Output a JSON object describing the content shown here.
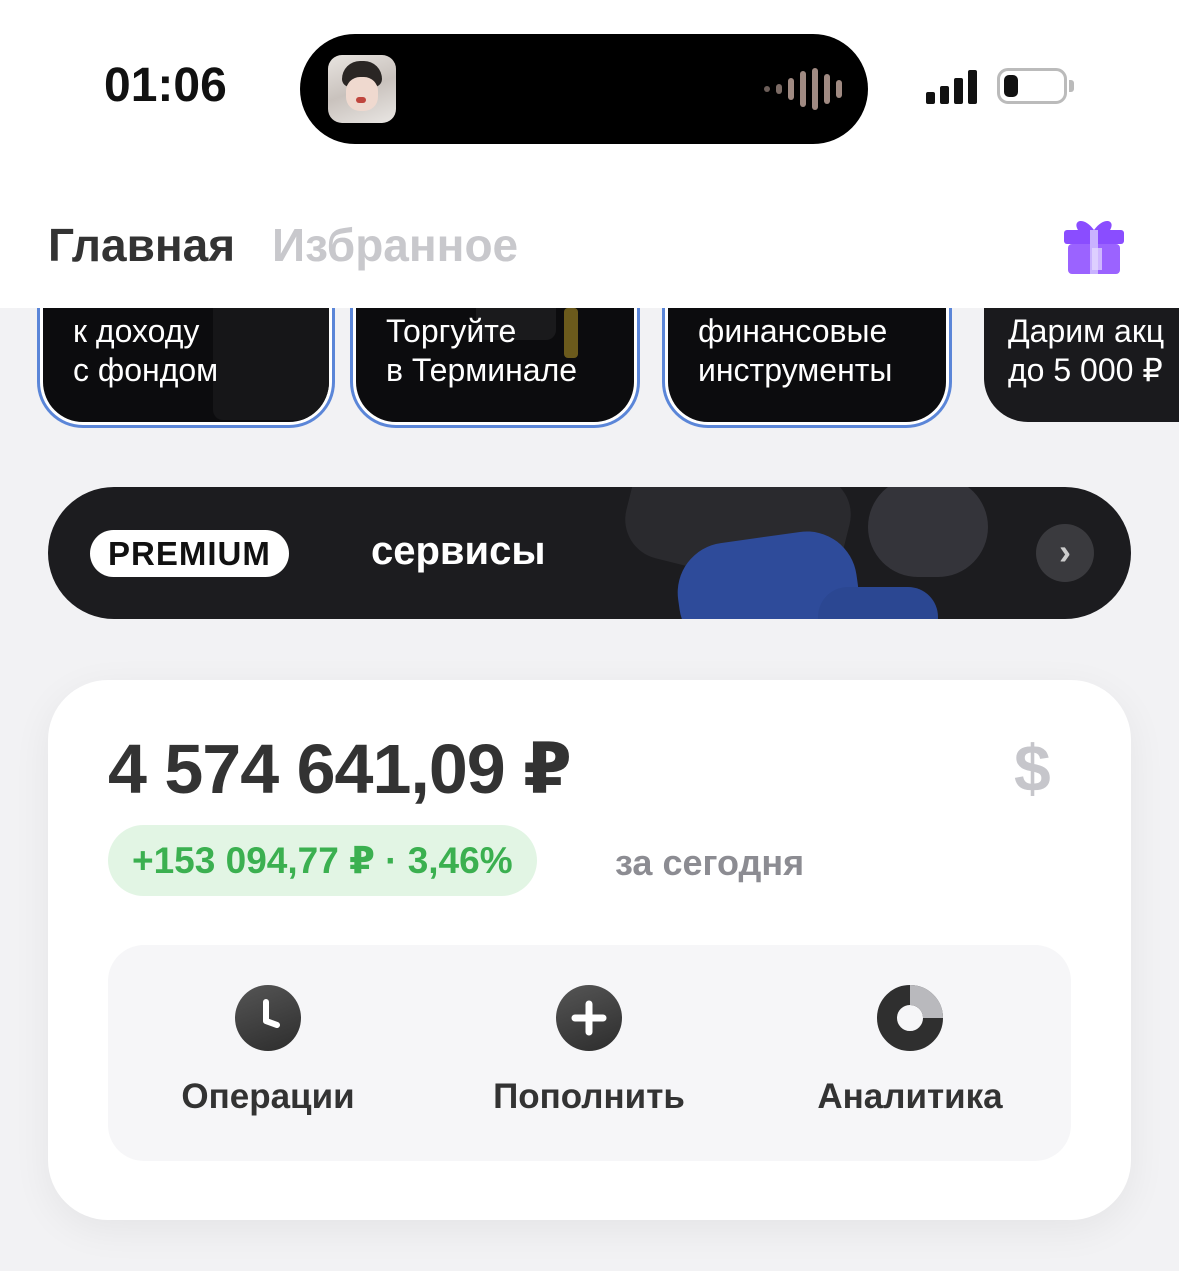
{
  "status_bar": {
    "time": "01:06"
  },
  "header": {
    "tabs": [
      {
        "label": "Главная",
        "active": true
      },
      {
        "label": "Избранное",
        "active": false
      }
    ],
    "gift_icon": "gift-icon"
  },
  "promo_cards": [
    {
      "line1": "к доходу",
      "line2": "с фондом",
      "outlined": true
    },
    {
      "line1": "Торгуйте",
      "line2": "в Терминале",
      "outlined": true
    },
    {
      "line1": "финансовые",
      "line2": "инструменты",
      "outlined": true
    },
    {
      "line1": "Дарим акц",
      "line2": "до 5 000 ₽",
      "outlined": false
    }
  ],
  "premium_banner": {
    "badge": "PREMIUM",
    "label": "сервисы",
    "chevron": "›"
  },
  "portfolio": {
    "balance": "4 574 641,09 ₽",
    "currency_switch": "$",
    "change": "+153 094,77 ₽ · 3,46%",
    "change_period": "за сегодня",
    "actions": [
      {
        "label": "Операции",
        "icon": "clock-icon"
      },
      {
        "label": "Пополнить",
        "icon": "plus-icon"
      },
      {
        "label": "Аналитика",
        "icon": "donut-chart-icon"
      }
    ]
  },
  "colors": {
    "accent_green": "#3bb050",
    "green_pill_bg": "#e2f5e4",
    "gift_purple": "#8a4dff",
    "card_outline": "#5b86d8"
  }
}
